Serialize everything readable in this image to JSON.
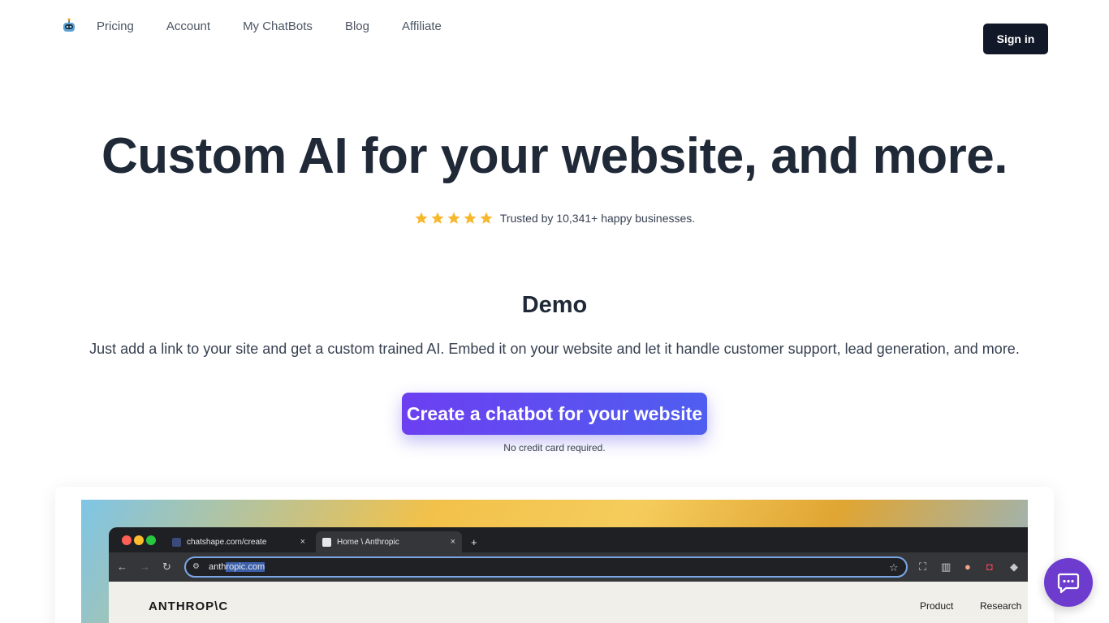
{
  "nav": {
    "logo_icon": "chatbot-logo-icon",
    "links": [
      "Pricing",
      "Account",
      "My ChatBots",
      "Blog",
      "Affiliate"
    ],
    "signin_label": "Sign in"
  },
  "hero": {
    "title": "Custom AI for your website, and more.",
    "stars": 5,
    "trust_text": "Trusted by 10,341+ happy businesses."
  },
  "demo": {
    "title": "Demo",
    "description": "Just add a link to your site and get a custom trained AI. Embed it on your website and let it handle customer support, lead generation, and more.",
    "cta_label": "Create a chatbot for your website",
    "cta_note": "No credit card required."
  },
  "preview": {
    "tabs": [
      {
        "label": "chatshape.com/create",
        "close": "×"
      },
      {
        "label": "Home \\ Anthropic",
        "close": "×"
      }
    ],
    "new_tab": "+",
    "url_prefix": "anth",
    "url_selected": "ropic.com",
    "site_logo": "ANTHROP\\C",
    "site_nav": [
      "Product",
      "Research"
    ]
  },
  "chat_widget": {
    "icon": "chat-bubble-icon"
  },
  "colors": {
    "brand_dark": "#111827",
    "cta_start": "#6c3ff1",
    "cta_end": "#4f5ef0",
    "star": "#f5b82e",
    "chat_fab": "#6d3ccf"
  }
}
